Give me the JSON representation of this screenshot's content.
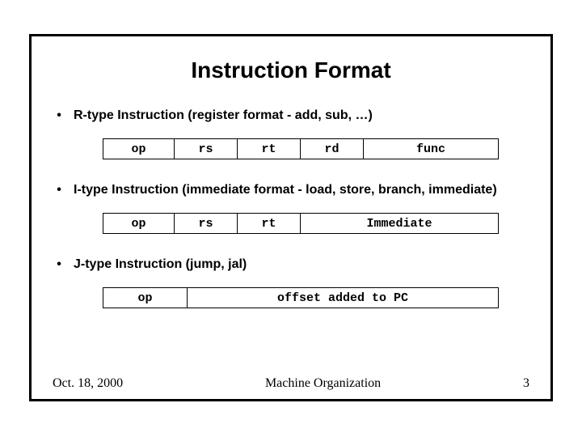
{
  "title": "Instruction Format",
  "bullets": {
    "r": "R-type Instruction (register format - add, sub, …)",
    "i": "I-type Instruction (immediate format - load, store, branch, immediate)",
    "j": "J-type Instruction (jump, jal)"
  },
  "rtype": {
    "op": "op",
    "rs": "rs",
    "rt": "rt",
    "rd": "rd",
    "func": "func"
  },
  "itype": {
    "op": "op",
    "rs": "rs",
    "rt": "rt",
    "imm": "Immediate"
  },
  "jtype": {
    "op": "op",
    "offset": "offset added to PC"
  },
  "footer": {
    "date": "Oct. 18, 2000",
    "mid": "Machine Organization",
    "page": "3"
  }
}
